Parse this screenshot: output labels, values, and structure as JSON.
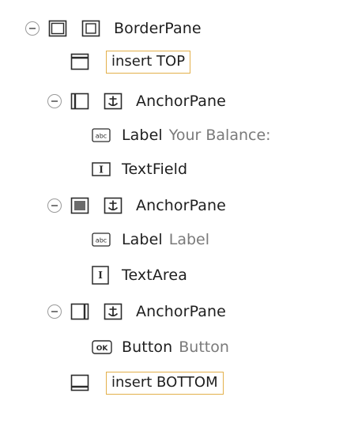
{
  "tree": {
    "root": {
      "label": "BorderPane"
    },
    "insert_top": {
      "label": "insert TOP"
    },
    "anchor_top": {
      "label": "AnchorPane"
    },
    "label1": {
      "type": "Label",
      "text": "Your Balance:"
    },
    "textfield": {
      "label": "TextField"
    },
    "anchor_center": {
      "label": "AnchorPane"
    },
    "label2": {
      "type": "Label",
      "text": "Label"
    },
    "textarea": {
      "label": "TextArea"
    },
    "anchor_bottom": {
      "label": "AnchorPane"
    },
    "button": {
      "type": "Button",
      "text": "Button"
    },
    "insert_bottom": {
      "label": "insert BOTTOM"
    }
  },
  "icons": {
    "label_glyph": "abc",
    "textinput_glyph": "I",
    "button_glyph": "OK"
  },
  "colors": {
    "insert_border": "#e3b04b",
    "secondary_text": "#7a7a7a",
    "icon_stroke": "#2b2b2b"
  }
}
